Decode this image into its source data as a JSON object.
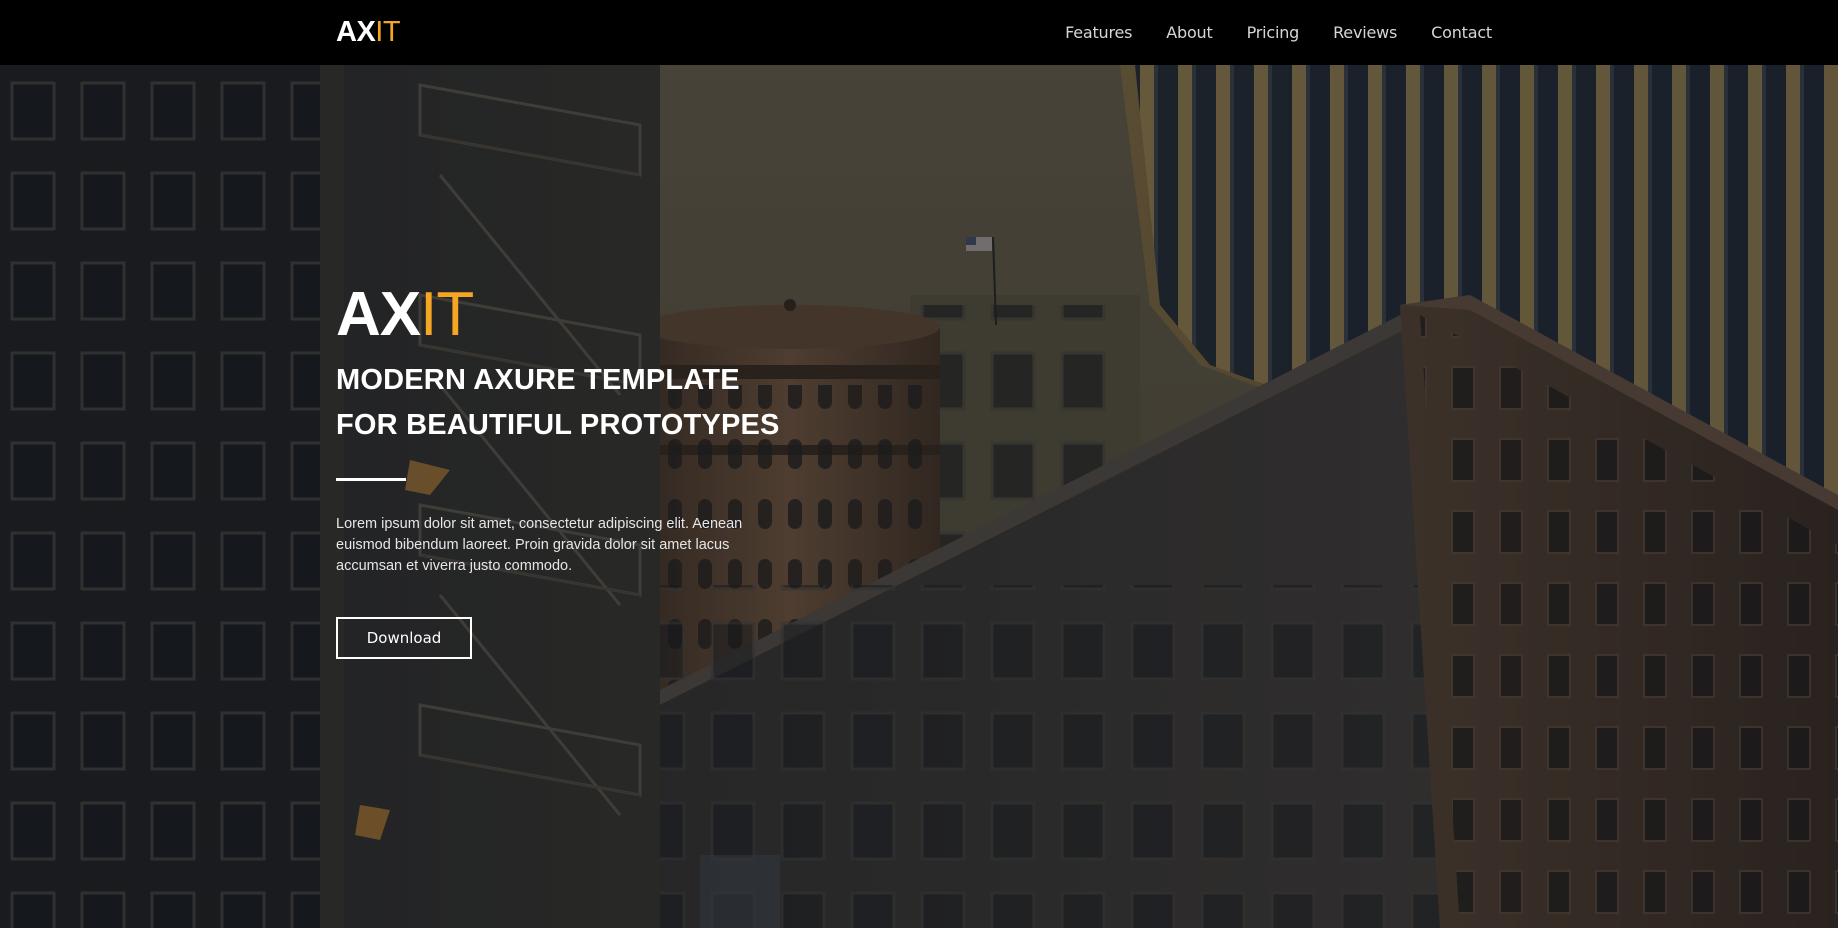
{
  "navbar": {
    "brand": {
      "primary": "AX",
      "accent": "IT"
    },
    "links": [
      {
        "label": "Features"
      },
      {
        "label": "About"
      },
      {
        "label": "Pricing"
      },
      {
        "label": "Reviews"
      },
      {
        "label": "Contact"
      }
    ]
  },
  "hero": {
    "logo": {
      "primary": "AX",
      "accent": "IT"
    },
    "heading_line1": "MODERN AXURE TEMPLATE",
    "heading_line2": "FOR BEAUTIFUL PROTOTYPES",
    "body": "Lorem ipsum dolor sit amet, consectetur adipiscing elit. Aenean euismod bibendum laoreet. Proin gravida dolor sit amet lacus accumsan et viverra justo commodo.",
    "cta_label": "Download"
  },
  "colors": {
    "accent": "#f5a623",
    "nav_background": "#000000",
    "text_primary": "#ffffff"
  }
}
